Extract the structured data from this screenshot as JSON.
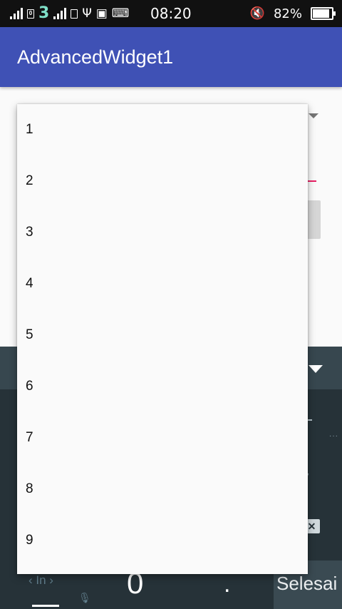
{
  "status_bar": {
    "time": "08:20",
    "battery_percent": "82%",
    "battery_level": 0.82,
    "sim_label_1": "0",
    "carrier_glyph": "3",
    "icons": [
      "signal-icon",
      "sim-icon",
      "carrier-three-icon",
      "signal-icon",
      "sim-icon",
      "usb-icon",
      "bbm-icon",
      "keyboard-icon",
      "mute-icon",
      "battery-icon"
    ]
  },
  "toolbar": {
    "title": "AdvancedWidget1"
  },
  "dropdown": {
    "items": [
      "1",
      "2",
      "3",
      "4",
      "5",
      "6",
      "7",
      "8",
      "9"
    ]
  },
  "keyboard": {
    "language_label": "In",
    "zero_key": "0",
    "period_key": ".",
    "delete_key": "✕",
    "done_label": "Selesai"
  },
  "colors": {
    "app_bar": "#3f51b5",
    "accent": "#e91e63",
    "status_bar": "#111111",
    "keyboard": "#263238"
  }
}
